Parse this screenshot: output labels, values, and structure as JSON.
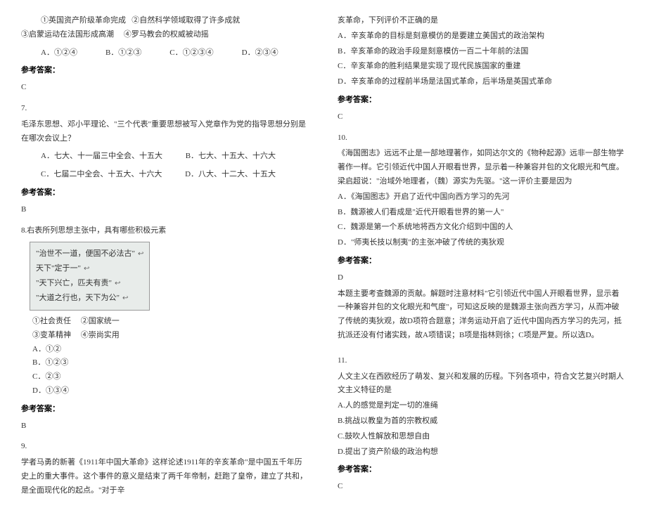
{
  "left": {
    "q6": {
      "line1_a": "①英国资产阶级革命完成",
      "line1_b": "②自然科学领域取得了许多成就",
      "line2_a": "③启蒙运动在法国形成高潮",
      "line2_b": "④罗马教会的权威被动摇",
      "optA": "A．①②④",
      "optB": "B．①②③",
      "optC": "C．①②③④",
      "optD": "D．②③④",
      "answer_label": "参考答案：",
      "answer": "C"
    },
    "q7": {
      "num": "7.",
      "body": "毛泽东思想、邓小平理论、\"三个代表\"重要思想被写入党章作为党的指导思想分别是在哪次会议上？",
      "optA": "A．七大、十一届三中全会、十五大",
      "optB": "B．七大、十五大、十六大",
      "optC": "C．七届二中全会、十五大、十六大",
      "optD": "D．八大、十二大、十五大",
      "answer_label": "参考答案：",
      "answer": "B"
    },
    "q8": {
      "num_body": "8.右表所列思想主张中，具有哪些积极元素",
      "quote1": "\"治世不一道，便国不必法古\"",
      "quote2": "天下\"定于一\"",
      "quote3": "\"天下兴亡，匹夫有责\"",
      "quote4": "\"大道之行也，天下为公\"",
      "item1": "①社会责任",
      "item2": "②国家统一",
      "item3": "③变革精神",
      "item4": "④崇尚实用",
      "vA": "A．①②",
      "vB": "B．①②③",
      "vC": "C．②③",
      "vD": "D．①③④",
      "answer_label": "参考答案：",
      "answer": "B"
    },
    "q9": {
      "num": "9.",
      "body": "学者马勇的新著《1911年中国大革命》这样论述1911年的辛亥革命\"是中国五千年历史上的重大事件。这个事件的意义是结束了两千年帝制，赶跑了皇帝，建立了共和，是全面现代化的起点。\"对于辛"
    }
  },
  "right": {
    "q9cont": {
      "cont": "亥革命，下列评价不正确的是",
      "optA": "A．辛亥革命的目标是刻意模仿的是要建立美国式的政治架构",
      "optB": "B．辛亥革命的政治手段是刻意模仿一百二十年前的法国",
      "optC": "C．辛亥革命的胜利结果是实现了现代民族国家的重建",
      "optD": "D．辛亥革命的过程前半场是法国式革命，后半场是英国式革命",
      "answer_label": "参考答案：",
      "answer": "C"
    },
    "q10": {
      "num": "10.",
      "body": "《海国图志》远远不止是一部地理著作，如同达尔文的《物种起源》远非一部生物学著作一样。它引领近代中国人开眼看世界，显示着一种兼容并包的文化眼光和气度。梁启超说：\"治域外地理者，（魏）源实为先驱。\"这一评价主要是因为",
      "optA": "A．《海国图志》开启了近代中国向西方学习的先河",
      "optB": "B．魏源被人们看成是\"近代开眼看世界的第一人\"",
      "optC": "C．魏源是第一个系统地将西方文化介绍到中国的人",
      "optD": "D．\"师夷长技以制夷\"的主张冲破了传统的夷狄观",
      "answer_label": "参考答案：",
      "answer": "D",
      "explain": "本题主要考查魏源的贡献。解题时注意材料\"它引领近代中国人开眼看世界，显示着一种兼容并包的文化眼光和气度\"，可知这反映的是魏源主张向西方学习，从而冲破了传统的夷狄观，故D项符合题意；洋务运动开启了近代中国向西方学习的先河，抵抗派还没有付诸实践，故A项错误；B项是指林则徐；C项是严复。所以选D。"
    },
    "q11": {
      "num": "11.",
      "body": "人文主义在西欧经历了萌发、复兴和发展的历程。下列各项中，符合文艺复兴时期人文主义特征的是",
      "optA": "A.人的感觉是判定一切的准绳",
      "optB": "B.挑战以教皇为首的宗教权威",
      "optC": "C.鼓吹人性解放和思想自由",
      "optD": "D.提出了资产阶级的政治构想",
      "answer_label": "参考答案：",
      "answer": "C"
    }
  }
}
